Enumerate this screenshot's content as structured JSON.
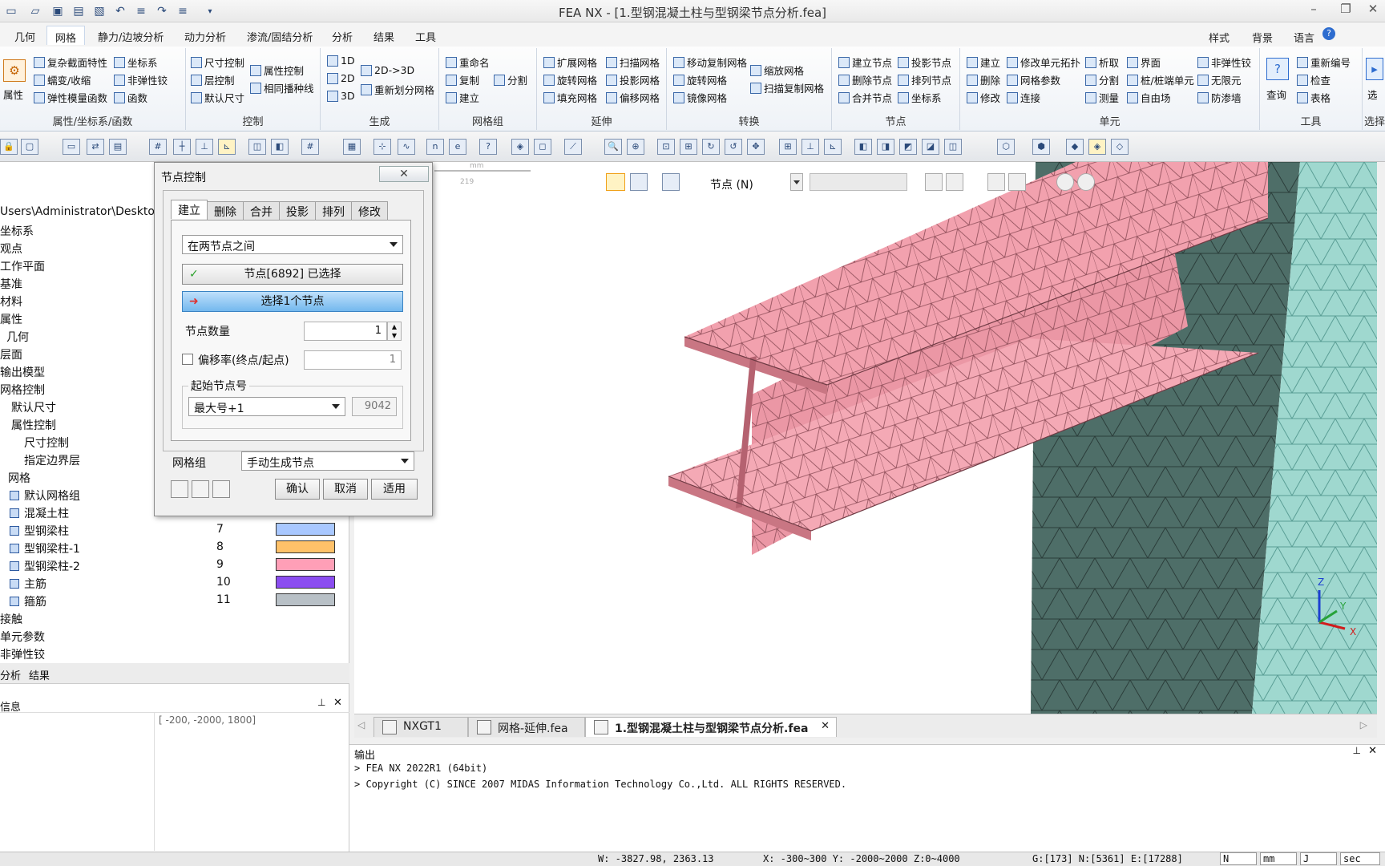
{
  "window": {
    "title": "FEA NX - [1.型钢混凝土柱与型钢梁节点分析.fea]"
  },
  "menu": {
    "tabs": [
      "几何",
      "网格",
      "静力/边坡分析",
      "动力分析",
      "渗流/固结分析",
      "分析",
      "结果",
      "工具"
    ],
    "active": "网格",
    "right": [
      "样式",
      "背景",
      "语言"
    ]
  },
  "ribbon": {
    "groups": [
      {
        "label": "属性/坐标系/函数",
        "big": "属性",
        "items": [
          "复杂截面特性",
          "坐标系",
          "蠕变/收缩",
          "非弹性铰",
          "弹性模量函数",
          "函数"
        ]
      },
      {
        "label": "控制",
        "items": [
          "尺寸控制",
          "属性控制",
          "层控制",
          "默认尺寸",
          "相同播种线"
        ]
      },
      {
        "label": "生成",
        "items": [
          "1D",
          "2D",
          "3D",
          "2D->3D",
          "重新划分网格"
        ]
      },
      {
        "label": "网格组",
        "items": [
          "重命名",
          "复制",
          "分割",
          "建立"
        ]
      },
      {
        "label": "延伸",
        "items": [
          "扩展网格",
          "扫描网格",
          "旋转网格",
          "投影网格",
          "填充网格",
          "偏移网格"
        ]
      },
      {
        "label": "转换",
        "items": [
          "移动复制网格",
          "缩放网格",
          "旋转网格",
          "扫描复制网格",
          "镜像网格"
        ]
      },
      {
        "label": "节点",
        "items": [
          "建立节点",
          "投影节点",
          "删除节点",
          "排列节点",
          "合并节点",
          "坐标系"
        ]
      },
      {
        "label": "单元",
        "items": [
          "建立",
          "修改单元拓扑",
          "析取",
          "界面",
          "非弹性铰",
          "删除",
          "网格参数",
          "分割",
          "桩/桩端单元",
          "无限元",
          "修改",
          "连接",
          "测量",
          "自由场",
          "防渗墙"
        ]
      },
      {
        "label": "工具",
        "big": "查询",
        "items": [
          "重新编号",
          "检查",
          "表格"
        ]
      },
      {
        "label": "选择",
        "big": "选"
      }
    ]
  },
  "tree": {
    "path": "Users\\Administrator\\Deskto",
    "items": [
      "坐标系",
      "观点",
      "工作平面",
      "基准",
      "材料",
      "属性",
      "几何",
      "层面",
      "输出模型",
      "网格控制",
      "默认尺寸",
      "属性控制",
      "尺寸控制",
      "指定边界层",
      "网格"
    ],
    "mesh_groups": [
      {
        "name": "默认网格组",
        "id": "",
        "color": ""
      },
      {
        "name": "混凝土柱",
        "id": "",
        "color": "#a8ddd4"
      },
      {
        "name": "型钢梁柱",
        "id": "7",
        "color": "#a9c8ff"
      },
      {
        "name": "型钢梁柱-1",
        "id": "8",
        "color": "#ffc169"
      },
      {
        "name": "型钢梁柱-2",
        "id": "9",
        "color": "#ff9fb7"
      },
      {
        "name": "主筋",
        "id": "10",
        "color": "#8b4df0"
      },
      {
        "name": "箍筋",
        "id": "11",
        "color": "#b8c0c6"
      }
    ],
    "tail": [
      "接触",
      "单元参数",
      "非弹性铰"
    ],
    "bottom_tabs": [
      "分析",
      "结果"
    ]
  },
  "info": {
    "title": "信息",
    "value": "[ -200, -2000, 1800]"
  },
  "dialog": {
    "title": "节点控制",
    "tabs": [
      "建立",
      "删除",
      "合并",
      "投影",
      "排列",
      "修改"
    ],
    "active_tab": "建立",
    "method": "在两节点之间",
    "node_selected": "节点[6892] 已选择",
    "select_one": "选择1个节点",
    "count_label": "节点数量",
    "count_value": "1",
    "offset_label": "偏移率(终点/起点)",
    "offset_value": "1",
    "start_label": "起始节点号",
    "start_mode": "最大号+1",
    "start_value": "9042",
    "group_label": "网格组",
    "group_value": "手动生成节点",
    "ok": "确认",
    "cancel": "取消",
    "apply": "适用"
  },
  "viewport": {
    "select_mode": "节点 (N)",
    "ruler_unit": "mm",
    "ruler_value": "219",
    "axes": [
      "Z",
      "Y",
      "X"
    ],
    "colors": {
      "beam": "#f2a1ae",
      "beam_edge": "#8a4a55",
      "column": "#4e6e68",
      "concrete": "#9fd8cf"
    }
  },
  "doc_tabs": [
    "NXGT1",
    "网格-延伸.fea",
    "1.型钢混凝土柱与型钢梁节点分析.fea"
  ],
  "output": {
    "title": "输出",
    "lines": [
      "> FEA NX 2022R1 (64bit)",
      "> Copyright (C) SINCE 2007 MIDAS Information Technology Co.,Ltd. ALL RIGHTS RESERVED."
    ]
  },
  "status": {
    "coords": "W: -3827.98, 2363.13",
    "range": "X: -300~300 Y: -2000~2000 Z:0~4000",
    "counts": "G:[173] N:[5361] E:[17288]",
    "units": [
      "N",
      "mm",
      "J",
      "sec"
    ]
  }
}
